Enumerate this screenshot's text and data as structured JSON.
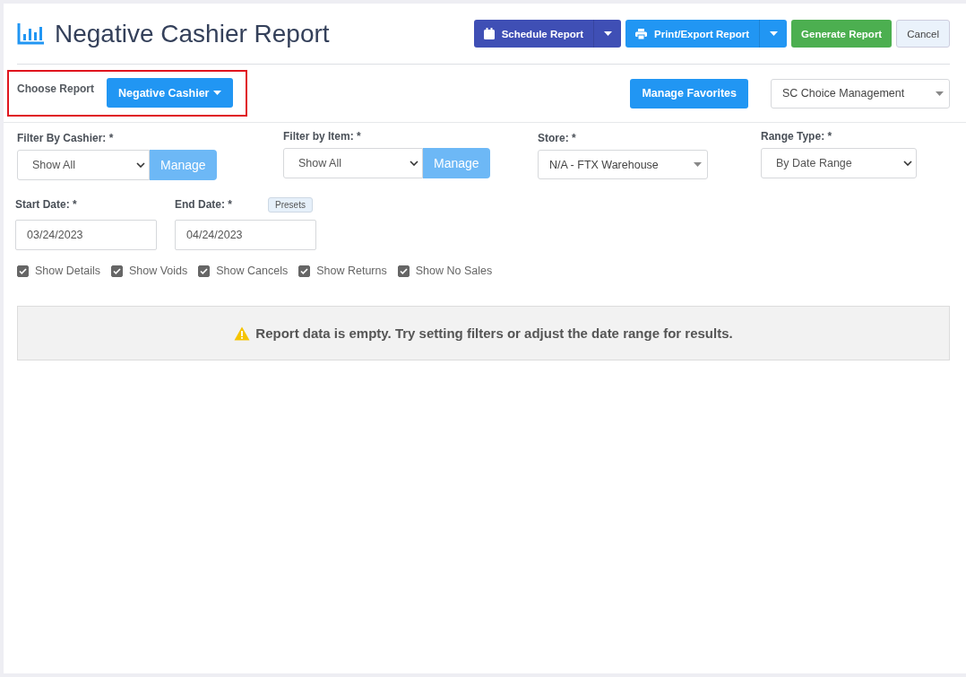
{
  "title": "Negative Cashier Report",
  "header_buttons": [
    {
      "label": "Schedule Report",
      "kind": "split"
    },
    {
      "label": "Print/Export Report",
      "kind": "split"
    },
    {
      "label": "Generate Report",
      "kind": "plain"
    },
    {
      "label": "Cancel",
      "kind": "plain"
    }
  ],
  "choose_report": {
    "label": "Choose Report",
    "value": "Negative Cashier"
  },
  "manage_favorites": "Manage Favorites",
  "company_select": "SC Choice Management",
  "filters": [
    {
      "label": "Filter By Cashier: *",
      "kind": "select-manage",
      "value": "Show All",
      "action": "Manage"
    },
    {
      "label": "Filter by Item: *",
      "kind": "select-manage",
      "value": "Show All",
      "action": "Manage"
    },
    {
      "label": "Store: *",
      "kind": "combo",
      "value": "N/A - FTX Warehouse"
    },
    {
      "label": "Range Type: *",
      "kind": "select",
      "value": "By Date Range"
    }
  ],
  "dates": [
    {
      "label": "Start Date: *",
      "value": "03/24/2023"
    },
    {
      "label": "End Date: *",
      "value": "04/24/2023",
      "presets": "Presets"
    }
  ],
  "options": [
    {
      "label": "Show Details",
      "checked": true
    },
    {
      "label": "Show Voids",
      "checked": true
    },
    {
      "label": "Show Cancels",
      "checked": true
    },
    {
      "label": "Show Returns",
      "checked": true
    },
    {
      "label": "Show No Sales",
      "checked": true
    }
  ],
  "alert": "Report data is empty. Try setting filters or adjust the date range for results."
}
